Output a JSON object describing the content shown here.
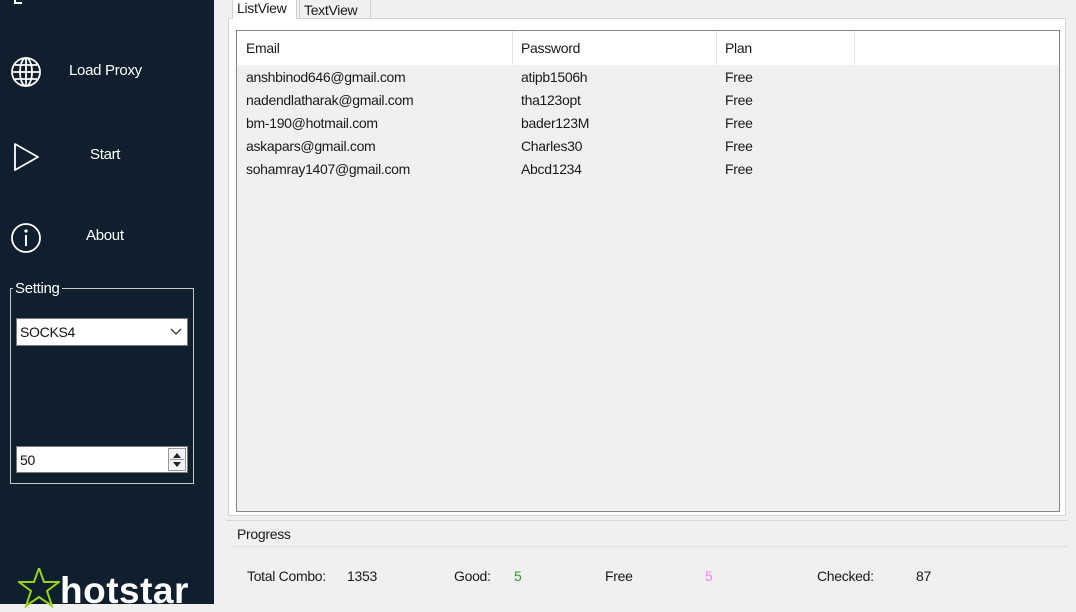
{
  "sidebar": {
    "load_proxy_label": "Load Proxy",
    "start_label": "Start",
    "about_label": "About",
    "setting_legend": "Setting",
    "proxy_type": "SOCKS4",
    "threads": "50",
    "logo_text": "hotstar",
    "icons": [
      "globe-icon",
      "play-icon",
      "info-icon",
      "chevron-down-icon",
      "spin-updown-icon",
      "hotstar-logo"
    ]
  },
  "tabs": [
    "ListView",
    "TextView"
  ],
  "listview": {
    "columns": [
      "Email",
      "Password",
      "Plan",
      ""
    ],
    "rows": [
      {
        "email": "anshbinod646@gmail.com",
        "password": "atipb1506h",
        "plan": "Free"
      },
      {
        "email": "nadendlatharak@gmail.com",
        "password": "tha123opt",
        "plan": "Free"
      },
      {
        "email": "bm-190@hotmail.com",
        "password": "bader123M",
        "plan": "Free"
      },
      {
        "email": "askapars@gmail.com",
        "password": "Charles30",
        "plan": "Free"
      },
      {
        "email": "sohamray1407@gmail.com",
        "password": "Abcd1234",
        "plan": "Free"
      }
    ]
  },
  "progress": {
    "title": "Progress",
    "total_combo_label": "Total Combo:",
    "total_combo": "1353",
    "good_label": "Good:",
    "good": "5",
    "free_label": "Free",
    "free": "5",
    "checked_label": "Checked:",
    "checked": "87"
  },
  "colors": {
    "sidebar_bg": "#0f1f2e",
    "good_value": "#2e9a2e",
    "free_value": "#ee82ee",
    "logo_accent": "#9ad11f"
  }
}
